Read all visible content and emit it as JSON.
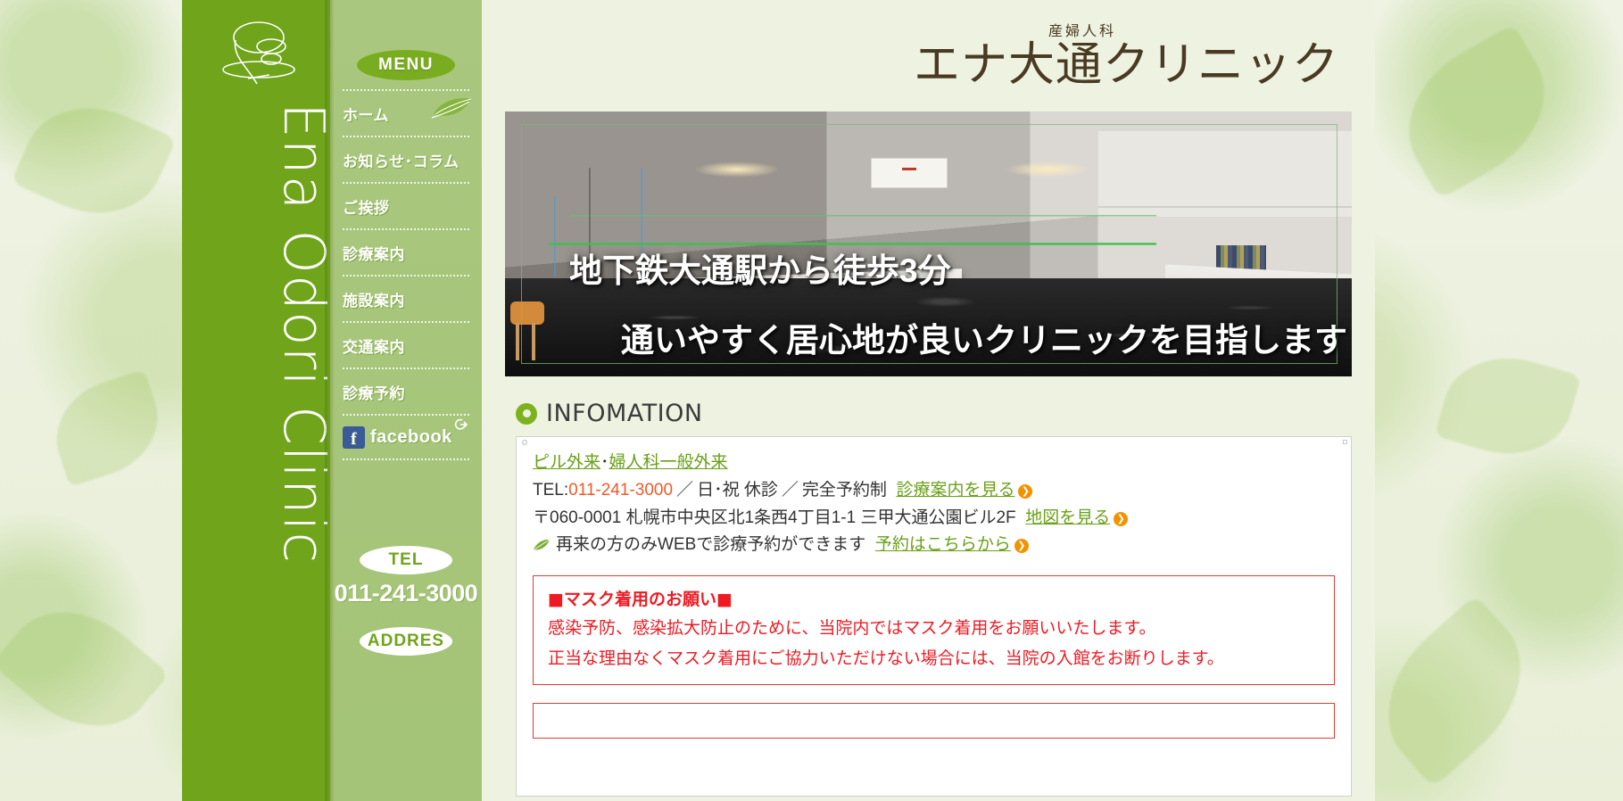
{
  "brand": {
    "vertical_name": "Ena Odori Clinic",
    "logo_sub": "産婦人科",
    "logo_main": "エナ大通クリニック"
  },
  "sidebar": {
    "menu_label": "MENU",
    "items": [
      {
        "label": "ホーム"
      },
      {
        "label": "お知らせ･コラム"
      },
      {
        "label": "ご挨拶"
      },
      {
        "label": "診療案内"
      },
      {
        "label": "施設案内"
      },
      {
        "label": "交通案内"
      },
      {
        "label": "診療予約"
      },
      {
        "label": "facebook"
      }
    ],
    "tel_label": "TEL",
    "tel_number": "011-241-3000",
    "address_label": "ADDRES"
  },
  "hero": {
    "line1": "地下鉄大通駅から徒歩3分",
    "line2": "通いやすく居心地が良いクリニックを目指します"
  },
  "information": {
    "heading": "INFOMATION",
    "link_pill": "ピル外来",
    "link_gyn": "婦人科一般外来",
    "dot": "･",
    "tel_prefix": "TEL:",
    "tel_number": "011-241-3000",
    "sep1": "／",
    "closed": "日･祝 休診",
    "sep2": "／",
    "reservation_only": "完全予約制",
    "link_clinic_guide": "診療案内を見る",
    "address": "〒060-0001 札幌市中央区北1条西4丁目1-1 三甲大通公園ビル2F",
    "link_map": "地図を見る",
    "web_reservation_text": "再来の方のみWEBで診療予約ができます",
    "link_reserve": "予約はこちらから",
    "arrow": "❯"
  },
  "notice": {
    "title": "■マスク着用のお願い■",
    "line1": "感染予防、感染拡大防止のために、当院内ではマスク着用をお願いいたします。",
    "line2": "正当な理由なくマスク着用にご協力いただけない場合には、当院の入館をお断りします。"
  },
  "colors": {
    "rail_green": "#6fa41b",
    "menu_green": "#a9c77e",
    "accent_green": "#7db21f",
    "link_green": "#6aa017",
    "tel_orange": "#f05a28",
    "notice_red": "#ee1b24",
    "page_bg": "#eef3e1",
    "logo_brown": "#4b3a23"
  }
}
